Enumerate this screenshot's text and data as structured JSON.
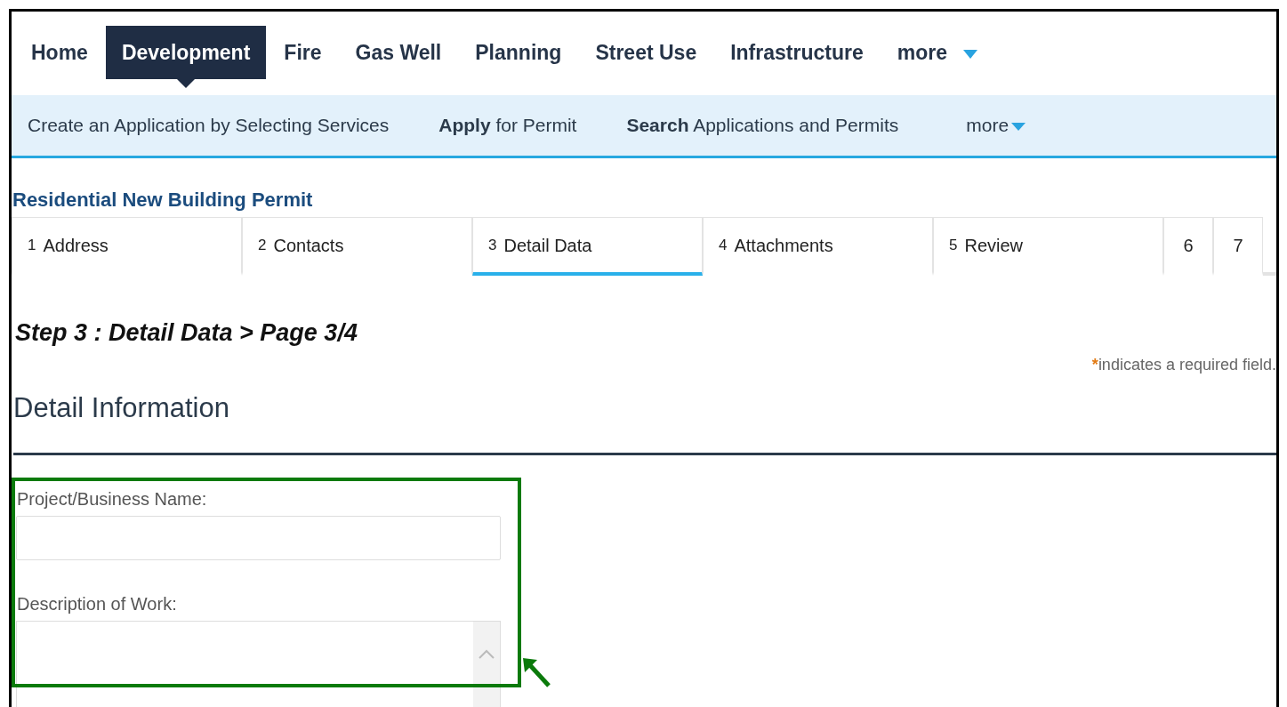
{
  "main_nav": [
    {
      "label": "Home",
      "selected": false
    },
    {
      "label": "Development",
      "selected": true
    },
    {
      "label": "Fire",
      "selected": false
    },
    {
      "label": "Gas Well",
      "selected": false
    },
    {
      "label": "Planning",
      "selected": false
    },
    {
      "label": "Street Use",
      "selected": false
    },
    {
      "label": "Infrastructure",
      "selected": false
    },
    {
      "label": "more",
      "kind": "dropdown",
      "selected": false
    }
  ],
  "sub_nav": [
    {
      "label": "Create an Application by Selecting Services",
      "kind": "link"
    },
    {
      "label": "**Apply** for Permit",
      "kind": "link"
    },
    {
      "label": "**Search** Applications and Permits",
      "kind": "link"
    },
    {
      "label": "more",
      "kind": "dropdown"
    }
  ],
  "permit_title": "Residential New Building Permit",
  "steps": [
    {
      "number": "1",
      "label": "Address",
      "selected": false
    },
    {
      "number": "2",
      "label": "Contacts",
      "selected": false
    },
    {
      "number": "3",
      "label": "Detail Data",
      "selected": true
    },
    {
      "number": "4",
      "label": "Attachments",
      "selected": false
    },
    {
      "number": "5",
      "label": "Review",
      "selected": false
    },
    {
      "number": "6",
      "selected": false
    },
    {
      "number": "7",
      "selected": false
    }
  ],
  "step_heading": "Step 3 : Detail Data > Page 3/4",
  "required_mark": "*",
  "required_note": "indicates a required field.",
  "section_title": "Detail Information",
  "fields": [
    {
      "label": "Project/Business Name:",
      "kind": "input"
    },
    {
      "label": "Description of Work:",
      "kind": "textarea"
    }
  ]
}
